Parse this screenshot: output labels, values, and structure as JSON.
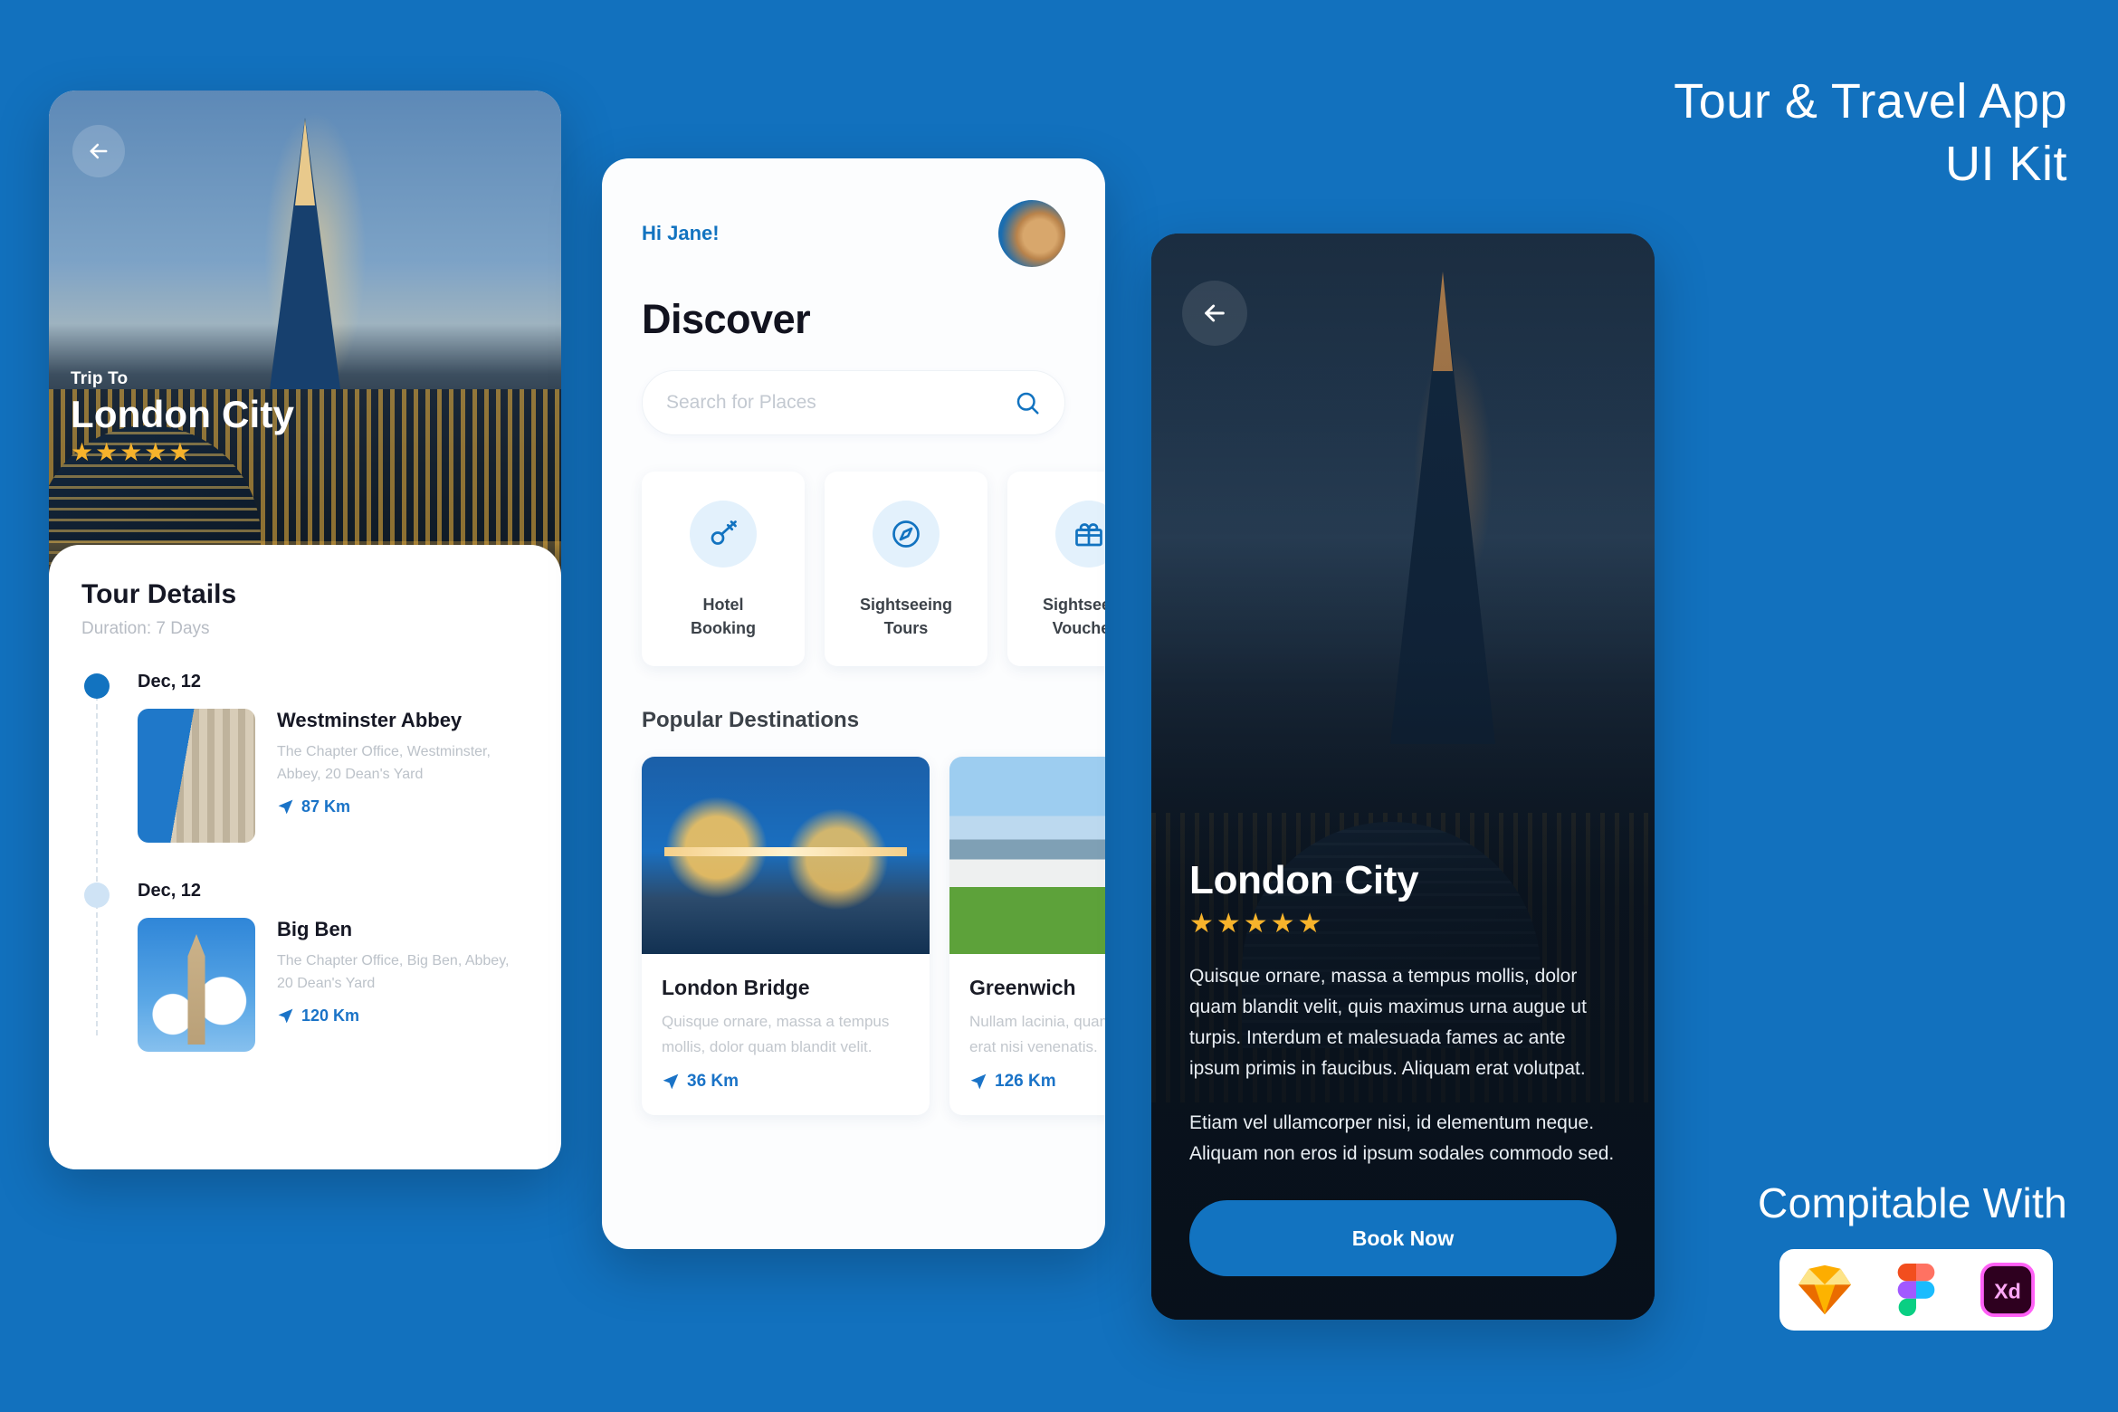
{
  "promo": {
    "title_line1": "Tour & Travel App",
    "title_line2": "UI Kit",
    "compatible_label": "Compitable With",
    "logos": [
      "sketch-logo",
      "figma-logo",
      "adobe-xd-logo"
    ]
  },
  "colors": {
    "background_blue": "#1271be",
    "accent_blue": "#1273c0",
    "star_gold": "#f7b32b",
    "muted_text": "#c2c7cd",
    "heading_dark": "#151724"
  },
  "screen_tour_details": {
    "back_icon": "arrow-left-icon",
    "hero": {
      "eyebrow": "Trip To",
      "title": "London City",
      "rating": 5,
      "stars": "★★★★★"
    },
    "sheet": {
      "title": "Tour Details",
      "subtitle": "Duration: 7 Days"
    },
    "itinerary": [
      {
        "date": "Dec, 12",
        "active": true,
        "name": "Westminster Abbey",
        "address": "The Chapter Office, Westminster, Abbey, 20 Dean's Yard",
        "distance": "87 Km",
        "distance_icon": "navigation-arrow-icon"
      },
      {
        "date": "Dec, 12",
        "active": false,
        "name": "Big Ben",
        "address": "The Chapter Office, Big Ben, Abbey, 20 Dean's Yard",
        "distance": "120 Km",
        "distance_icon": "navigation-arrow-icon"
      }
    ]
  },
  "screen_discover": {
    "greeting": "Hi Jane!",
    "avatar": "user-avatar",
    "page_title": "Discover",
    "search": {
      "placeholder": "Search for Places",
      "value": "",
      "icon": "search-icon"
    },
    "categories": [
      {
        "label": "Hotel\nBooking",
        "label_line1": "Hotel",
        "label_line2": "Booking",
        "icon": "key-icon"
      },
      {
        "label": "Sightseeing\nTours",
        "label_line1": "Sightseeing",
        "label_line2": "Tours",
        "icon": "compass-icon"
      },
      {
        "label": "Sightseeing\nVouchers",
        "label_line1": "Sightseeing",
        "label_line2": "Vouchers",
        "icon": "gift-icon"
      }
    ],
    "section_title": "Popular Destinations",
    "destinations": [
      {
        "name": "London Bridge",
        "description": "Quisque ornare, massa a tempus mollis, dolor quam blandit velit.",
        "distance": "36 Km",
        "image": "london-bridge-photo"
      },
      {
        "name": "Greenwich",
        "description": "Nullam lacinia, quam at dapibus, erat nisi venenatis.",
        "distance": "126 Km",
        "image": "greenwich-photo"
      }
    ]
  },
  "screen_detail": {
    "back_icon": "arrow-left-icon",
    "title": "London City",
    "rating": 5,
    "stars": "★★★★★",
    "paragraph1": "Quisque ornare, massa a tempus mollis, dolor quam blandit velit, quis maximus urna augue ut turpis. Interdum et malesuada fames ac ante ipsum primis in faucibus. Aliquam erat volutpat.",
    "paragraph2": "Etiam vel ullamcorper nisi, id elementum neque. Aliquam non eros id ipsum sodales commodo sed.",
    "cta_label": "Book Now"
  }
}
